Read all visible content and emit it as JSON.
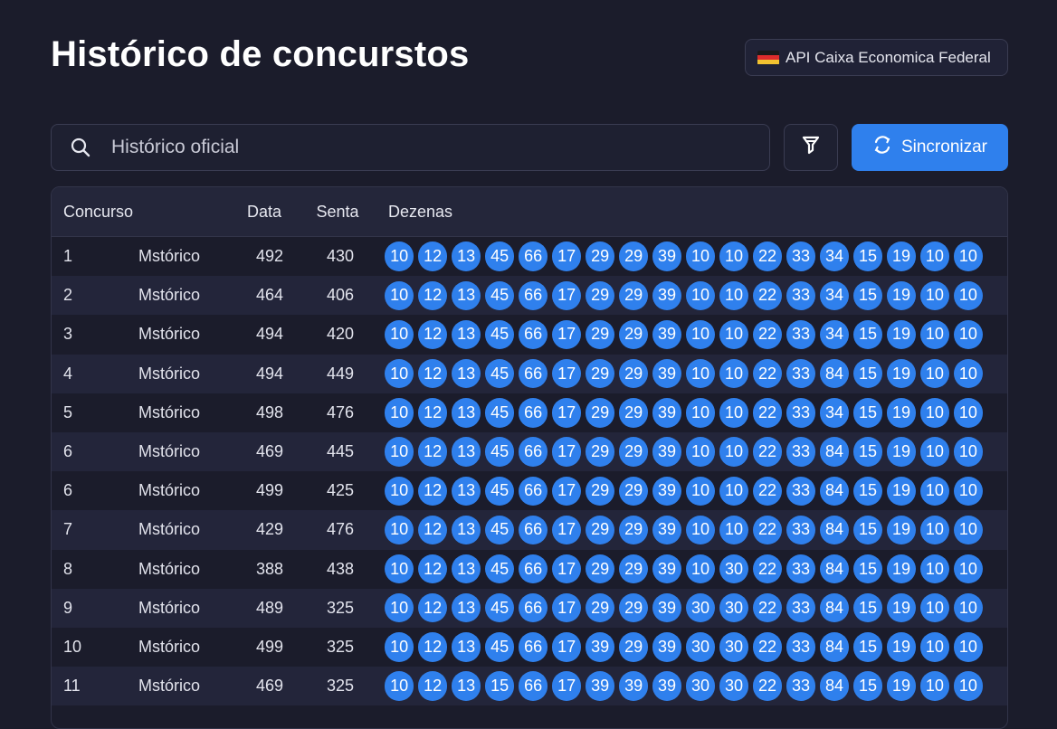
{
  "page": {
    "title": "Histórico de concurstos"
  },
  "api_badge": {
    "label": "API Caixa Economica Federal",
    "flag_icon": "german-flag-icon"
  },
  "search": {
    "value": "Histórico oficial",
    "icon": "search-icon"
  },
  "filter": {
    "icon": "filter-funnel-icon"
  },
  "sync": {
    "label": "Sincronizar",
    "icon": "sync-icon"
  },
  "colors": {
    "accent": "#2f80ed",
    "background": "#1b1c2b"
  },
  "table": {
    "headers": {
      "concurso": "Concurso",
      "data": "Data",
      "senta": "Senta",
      "dezenas": "Dezenas"
    },
    "rows": [
      {
        "concurso": "1",
        "label": "Mstórico",
        "data": "492",
        "senta": "430",
        "dezenas": [
          "10",
          "12",
          "13",
          "45",
          "66",
          "17",
          "29",
          "29",
          "39",
          "10",
          "10",
          "22",
          "33",
          "34",
          "15",
          "19",
          "10",
          "10"
        ]
      },
      {
        "concurso": "2",
        "label": "Mstórico",
        "data": "464",
        "senta": "406",
        "dezenas": [
          "10",
          "12",
          "13",
          "45",
          "66",
          "17",
          "29",
          "29",
          "39",
          "10",
          "10",
          "22",
          "33",
          "34",
          "15",
          "19",
          "10",
          "10"
        ]
      },
      {
        "concurso": "3",
        "label": "Mstórico",
        "data": "494",
        "senta": "420",
        "dezenas": [
          "10",
          "12",
          "13",
          "45",
          "66",
          "17",
          "29",
          "29",
          "39",
          "10",
          "10",
          "22",
          "33",
          "34",
          "15",
          "19",
          "10",
          "10"
        ]
      },
      {
        "concurso": "4",
        "label": "Mstórico",
        "data": "494",
        "senta": "449",
        "dezenas": [
          "10",
          "12",
          "13",
          "45",
          "66",
          "17",
          "29",
          "29",
          "39",
          "10",
          "10",
          "22",
          "33",
          "84",
          "15",
          "19",
          "10",
          "10"
        ]
      },
      {
        "concurso": "5",
        "label": "Mstórico",
        "data": "498",
        "senta": "476",
        "dezenas": [
          "10",
          "12",
          "13",
          "45",
          "66",
          "17",
          "29",
          "29",
          "39",
          "10",
          "10",
          "22",
          "33",
          "34",
          "15",
          "19",
          "10",
          "10"
        ]
      },
      {
        "concurso": "6",
        "label": "Mstórico",
        "data": "469",
        "senta": "445",
        "dezenas": [
          "10",
          "12",
          "13",
          "45",
          "66",
          "17",
          "29",
          "29",
          "39",
          "10",
          "10",
          "22",
          "33",
          "84",
          "15",
          "19",
          "10",
          "10"
        ]
      },
      {
        "concurso": "6",
        "label": "Mstórico",
        "data": "499",
        "senta": "425",
        "dezenas": [
          "10",
          "12",
          "13",
          "45",
          "66",
          "17",
          "29",
          "29",
          "39",
          "10",
          "10",
          "22",
          "33",
          "84",
          "15",
          "19",
          "10",
          "10"
        ]
      },
      {
        "concurso": "7",
        "label": "Mstórico",
        "data": "429",
        "senta": "476",
        "dezenas": [
          "10",
          "12",
          "13",
          "45",
          "66",
          "17",
          "29",
          "29",
          "39",
          "10",
          "10",
          "22",
          "33",
          "84",
          "15",
          "19",
          "10",
          "10"
        ]
      },
      {
        "concurso": "8",
        "label": "Mstórico",
        "data": "388",
        "senta": "438",
        "dezenas": [
          "10",
          "12",
          "13",
          "45",
          "66",
          "17",
          "29",
          "29",
          "39",
          "10",
          "30",
          "22",
          "33",
          "84",
          "15",
          "19",
          "10",
          "10"
        ]
      },
      {
        "concurso": "9",
        "label": "Mstórico",
        "data": "489",
        "senta": "325",
        "dezenas": [
          "10",
          "12",
          "13",
          "45",
          "66",
          "17",
          "29",
          "29",
          "39",
          "30",
          "30",
          "22",
          "33",
          "84",
          "15",
          "19",
          "10",
          "10"
        ]
      },
      {
        "concurso": "10",
        "label": "Mstórico",
        "data": "499",
        "senta": "325",
        "dezenas": [
          "10",
          "12",
          "13",
          "45",
          "66",
          "17",
          "39",
          "29",
          "39",
          "30",
          "30",
          "22",
          "33",
          "84",
          "15",
          "19",
          "10",
          "10"
        ]
      },
      {
        "concurso": "11",
        "label": "Mstórico",
        "data": "469",
        "senta": "325",
        "dezenas": [
          "10",
          "12",
          "13",
          "15",
          "66",
          "17",
          "39",
          "39",
          "39",
          "30",
          "30",
          "22",
          "33",
          "84",
          "15",
          "19",
          "10",
          "10"
        ]
      }
    ]
  }
}
